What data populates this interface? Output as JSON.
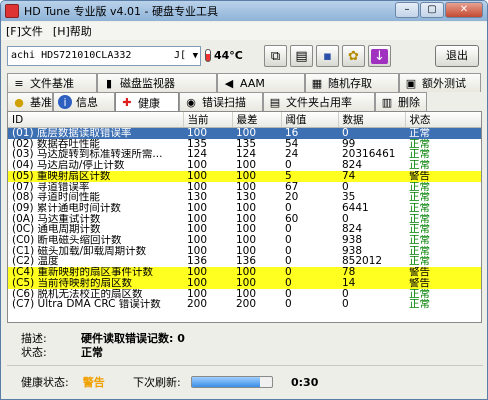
{
  "window": {
    "title": "HD Tune 专业版 v4.01 - 硬盘专业工具"
  },
  "menu": {
    "file": "[F]文件",
    "help": "[H]帮助"
  },
  "toolbar": {
    "drive_name": "achi HDS721010CLA332",
    "drive_suffix": "J[",
    "temperature": "44°C",
    "exit_label": "退出"
  },
  "tabs_top": [
    {
      "label": "文件基准",
      "icon": "file-benchmark-icon",
      "glyph": "≡"
    },
    {
      "label": "磁盘监视器",
      "icon": "disk-monitor-icon",
      "glyph": "▮"
    },
    {
      "label": "AAM",
      "icon": "speaker-icon",
      "glyph": "◀"
    },
    {
      "label": "随机存取",
      "icon": "random-access-icon",
      "glyph": "▦"
    },
    {
      "label": "额外测试",
      "icon": "extra-tests-icon",
      "glyph": "▣"
    }
  ],
  "tabs_bottom": [
    {
      "label": "基准",
      "icon": "benchmark-icon",
      "glyph": "●"
    },
    {
      "label": "信息",
      "icon": "info-icon",
      "glyph": "i"
    },
    {
      "label": "健康",
      "icon": "health-cross-icon",
      "glyph": "✚"
    },
    {
      "label": "错误扫描",
      "icon": "error-scan-icon",
      "glyph": "◉"
    },
    {
      "label": "文件夹占用率",
      "icon": "folder-usage-icon",
      "glyph": "▤"
    },
    {
      "label": "删除",
      "icon": "erase-icon",
      "glyph": "▥"
    }
  ],
  "table": {
    "headers": [
      "ID",
      "当前",
      "最差",
      "阈值",
      "数据",
      "状态"
    ],
    "rows": [
      {
        "id": "(01) 底层数据读取错误率",
        "cur": "100",
        "worst": "100",
        "thr": "16",
        "data": "0",
        "status": "正常",
        "kind": "sel"
      },
      {
        "id": "(02) 数据吞吐性能",
        "cur": "135",
        "worst": "135",
        "thr": "54",
        "data": "99",
        "status": "正常",
        "kind": ""
      },
      {
        "id": "(03) 马达旋转到标准转速所需...",
        "cur": "124",
        "worst": "124",
        "thr": "24",
        "data": "20316461",
        "status": "正常",
        "kind": ""
      },
      {
        "id": "(04) 马达启动/停止计数",
        "cur": "100",
        "worst": "100",
        "thr": "0",
        "data": "824",
        "status": "正常",
        "kind": ""
      },
      {
        "id": "(05) 重映射扇区计数",
        "cur": "100",
        "worst": "100",
        "thr": "5",
        "data": "74",
        "status": "警告",
        "kind": "warn"
      },
      {
        "id": "(07) 寻道错误率",
        "cur": "100",
        "worst": "100",
        "thr": "67",
        "data": "0",
        "status": "正常",
        "kind": ""
      },
      {
        "id": "(08) 寻道时间性能",
        "cur": "130",
        "worst": "130",
        "thr": "20",
        "data": "35",
        "status": "正常",
        "kind": ""
      },
      {
        "id": "(09) 累计通电时间计数",
        "cur": "100",
        "worst": "100",
        "thr": "0",
        "data": "6441",
        "status": "正常",
        "kind": ""
      },
      {
        "id": "(0A) 马达重试计数",
        "cur": "100",
        "worst": "100",
        "thr": "60",
        "data": "0",
        "status": "正常",
        "kind": ""
      },
      {
        "id": "(0C) 通电周期计数",
        "cur": "100",
        "worst": "100",
        "thr": "0",
        "data": "824",
        "status": "正常",
        "kind": ""
      },
      {
        "id": "(C0) 断电磁头缩回计数",
        "cur": "100",
        "worst": "100",
        "thr": "0",
        "data": "938",
        "status": "正常",
        "kind": ""
      },
      {
        "id": "(C1) 磁头加载/卸载周期计数",
        "cur": "100",
        "worst": "100",
        "thr": "0",
        "data": "938",
        "status": "正常",
        "kind": ""
      },
      {
        "id": "(C2) 温度",
        "cur": "136",
        "worst": "136",
        "thr": "0",
        "data": "852012",
        "status": "正常",
        "kind": ""
      },
      {
        "id": "(C4) 重新映射的扇区事件计数",
        "cur": "100",
        "worst": "100",
        "thr": "0",
        "data": "78",
        "status": "警告",
        "kind": "warn"
      },
      {
        "id": "(C5) 当前待映射的扇区数",
        "cur": "100",
        "worst": "100",
        "thr": "0",
        "data": "14",
        "status": "警告",
        "kind": "warn"
      },
      {
        "id": "(C6) 脱机无法校正的扇区数",
        "cur": "100",
        "worst": "100",
        "thr": "0",
        "data": "0",
        "status": "正常",
        "kind": ""
      },
      {
        "id": "(C7) Ultra DMA CRC 错误计数",
        "cur": "200",
        "worst": "200",
        "thr": "0",
        "data": "0",
        "status": "正常",
        "kind": ""
      }
    ]
  },
  "details": {
    "desc_label": "描述:",
    "desc_value": "硬件读取错误记数: 0",
    "status_label": "状态:",
    "status_value": "正常"
  },
  "statusbar": {
    "health_label": "健康状态:",
    "health_value": "警告",
    "next_refresh_label": "下次刷新:",
    "countdown": "0:30",
    "progress_fraction": 0.85
  }
}
